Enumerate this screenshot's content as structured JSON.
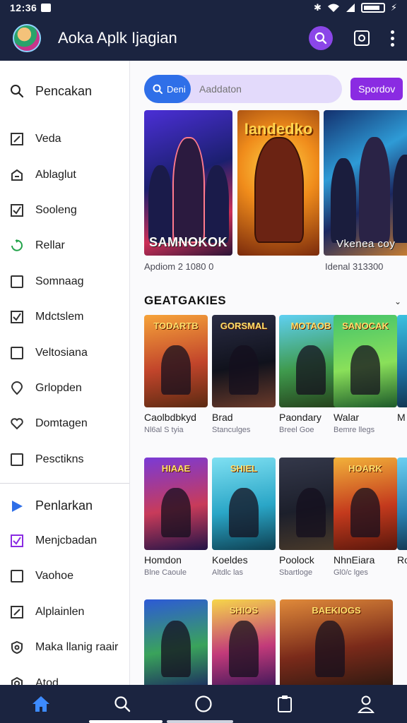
{
  "status_bar": {
    "time": "12:36"
  },
  "app_bar": {
    "title": "Aoka Aplk Ijagian"
  },
  "sidebar": {
    "top_item": "Pencakan",
    "items": [
      {
        "label": "Veda",
        "icon": "edit-icon"
      },
      {
        "label": "Ablaglut",
        "icon": "upload-icon"
      },
      {
        "label": "Sooleng",
        "icon": "checkbox-icon"
      },
      {
        "label": "Rellar",
        "icon": "refresh-icon"
      },
      {
        "label": "Somnaag",
        "icon": "square-icon"
      },
      {
        "label": "Mdctslem",
        "icon": "checkbox-icon"
      },
      {
        "label": "Veltosiana",
        "icon": "square-icon"
      },
      {
        "label": "Grlopden",
        "icon": "location-icon"
      },
      {
        "label": "Domtagen",
        "icon": "heart-icon"
      },
      {
        "label": "Pesctikns",
        "icon": "square-icon"
      }
    ],
    "section_item": "Penlarkan",
    "section_items": [
      {
        "label": "Menjcbadan",
        "icon": "checkbox-purple-icon"
      },
      {
        "label": "Vaohoe",
        "icon": "square-icon"
      },
      {
        "label": "Alplainlen",
        "icon": "edit-icon"
      },
      {
        "label": "Maka llanig raair",
        "icon": "shield-icon"
      },
      {
        "label": "Atod",
        "icon": "settings-icon"
      }
    ]
  },
  "search": {
    "pill_label": "Deni",
    "placeholder": "Aaddaton",
    "button_label": "Spordov"
  },
  "hero": {
    "cards": [
      {
        "title": "SAMNOKOK",
        "position": "bottom"
      },
      {
        "title": "Iandedko",
        "position": "top"
      },
      {
        "title": "Vkenea coy",
        "position": "bottom"
      }
    ],
    "meta_left": "Apdiom 2 1080 0",
    "meta_right": "Idenal 313300"
  },
  "section": {
    "title": "GEATGAKIES"
  },
  "rows": [
    [
      {
        "name": "Caolbdbkyd",
        "sub": "Nl6al S tyia",
        "art": "TODARTB"
      },
      {
        "name": "Brad",
        "sub": "Stanculges",
        "art": "GORSMAL"
      },
      {
        "name": "Paondary",
        "sub": "Breel Goe",
        "art": "MOTAOB"
      },
      {
        "name": "Walar",
        "sub": "Bemre llegs",
        "art": "SANOCAK"
      },
      {
        "name": "M",
        "sub": "",
        "art": ""
      }
    ],
    [
      {
        "name": "Homdon",
        "sub": "Blne Caoule",
        "art": "HIAAE"
      },
      {
        "name": "Koeldes",
        "sub": "Altdlc las",
        "art": "SHIEL"
      },
      {
        "name": "Poolock",
        "sub": "Sbartloge",
        "art": ""
      },
      {
        "name": "NhnEiara",
        "sub": "Gl0/c lges",
        "art": "HOARK"
      },
      {
        "name": "Ro",
        "sub": "",
        "art": ""
      }
    ],
    [
      {
        "name": "",
        "sub": "",
        "art": ""
      },
      {
        "name": "",
        "sub": "",
        "art": "SHIOS"
      },
      {
        "name": "",
        "sub": "",
        "art": "BAEKIOGS"
      }
    ]
  ],
  "colors": {
    "bar": "#1b2440",
    "accent_purple": "#8a2be2",
    "search_blue": "#2f6fe8"
  }
}
